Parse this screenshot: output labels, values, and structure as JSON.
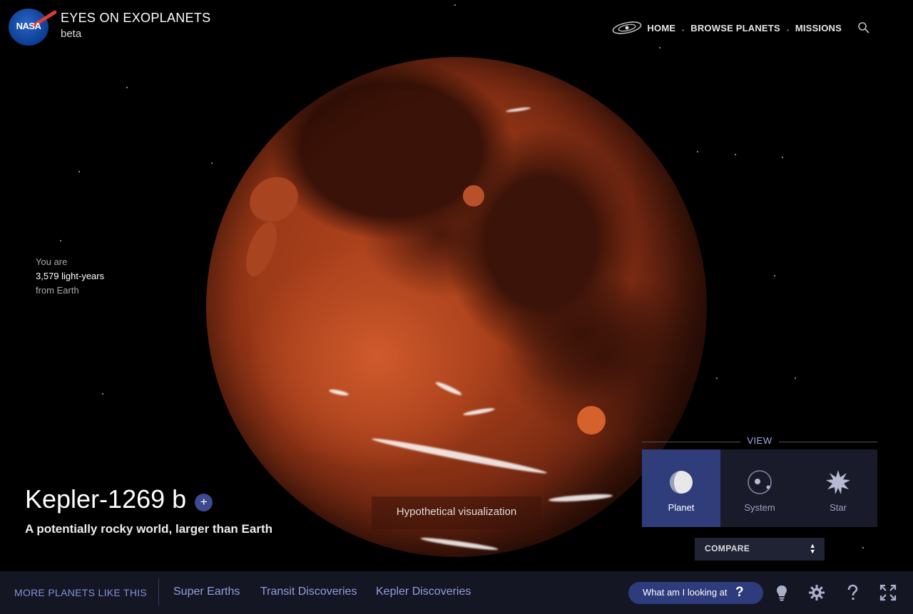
{
  "header": {
    "logo_text": "NASA",
    "title": "EYES ON EXOPLANETS",
    "subtitle": "beta",
    "nav": [
      "HOME",
      "BROWSE PLANETS",
      "MISSIONS"
    ],
    "icons": [
      "galaxy-icon",
      "search-icon"
    ]
  },
  "distance": {
    "line1": "You are",
    "value": "3,579 light-years",
    "line3": "from Earth"
  },
  "planet": {
    "name": "Kepler-1269 b",
    "add_label": "+",
    "description": "A potentially rocky world, larger than Earth",
    "visualization_note": "Hypothetical visualization"
  },
  "view": {
    "label": "VIEW",
    "options": [
      {
        "label": "Planet",
        "active": true,
        "icon": "planet-icon"
      },
      {
        "label": "System",
        "active": false,
        "icon": "system-icon"
      },
      {
        "label": "Star",
        "active": false,
        "icon": "star-icon"
      }
    ],
    "compare_label": "COMPARE"
  },
  "bottom": {
    "more_label": "MORE PLANETS LIKE THIS",
    "categories": [
      "Super Earths",
      "Transit Discoveries",
      "Kepler Discoveries"
    ],
    "what_label": "What am I looking at",
    "what_q": "?",
    "icons": [
      "lightbulb-icon",
      "settings-icon",
      "help-icon",
      "fullscreen-icon"
    ]
  },
  "colors": {
    "accent": "#2f3d7a",
    "link": "#8f9fdc",
    "bar_bg": "#141624",
    "planet": "#b5461f"
  }
}
